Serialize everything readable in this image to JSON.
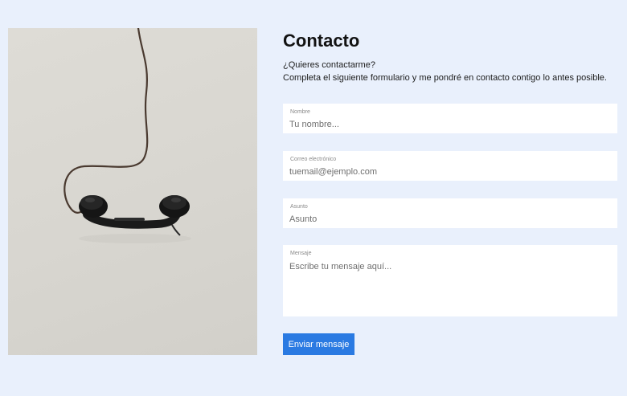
{
  "contact": {
    "title": "Contacto",
    "intro_line1": "¿Quieres contactarme?",
    "intro_line2": "Completa el siguiente formulario y me pondré en contacto contigo lo antes posible."
  },
  "form": {
    "name": {
      "label": "Nombre",
      "placeholder": "Tu nombre..."
    },
    "email": {
      "label": "Correo electrónico",
      "placeholder": "tuemail@ejemplo.com"
    },
    "subject": {
      "label": "Asunto",
      "placeholder": "Asunto"
    },
    "message": {
      "label": "Mensaje",
      "placeholder": "Escribe tu mensaje aquí..."
    },
    "submit_label": "Enviar mensaje"
  },
  "colors": {
    "page_background": "#e9f0fc",
    "accent": "#2a7ae2",
    "field_background": "#ffffff"
  }
}
